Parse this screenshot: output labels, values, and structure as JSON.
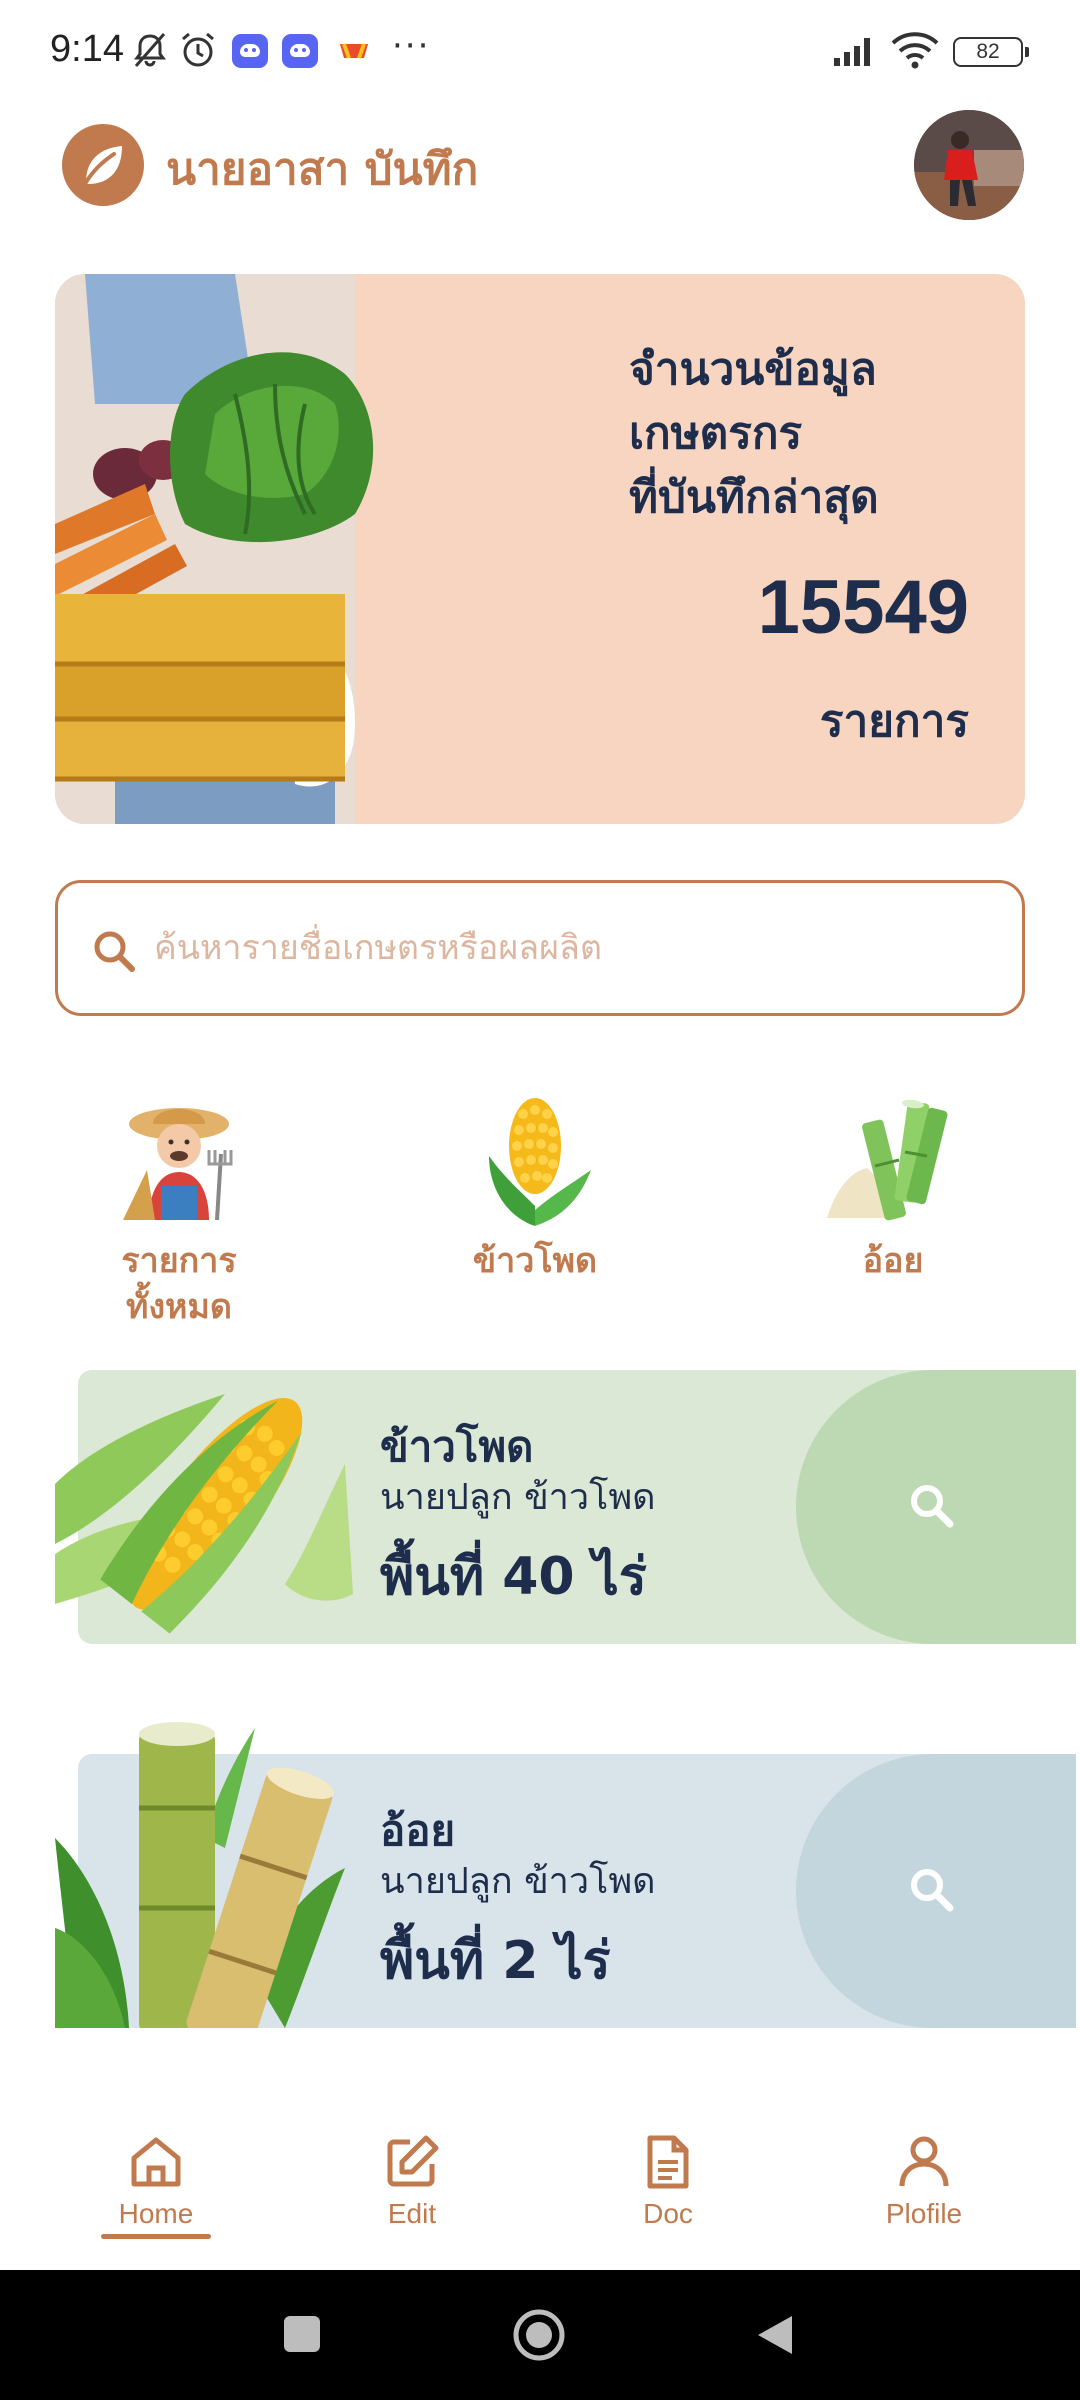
{
  "status_bar": {
    "time": "9:14",
    "battery": "82",
    "more": "···",
    "icons": [
      "bell-off-icon",
      "alarm-icon",
      "discord-icon",
      "discord-icon",
      "app-icon",
      "signal-icon",
      "wifi-icon",
      "battery-icon"
    ]
  },
  "header": {
    "title": "นายอาสา บันทึก",
    "logo_icon": "leaf-icon"
  },
  "hero": {
    "label_line1": "จำนวนข้อมูล",
    "label_line2": "เกษตรกร",
    "label_line3": "ที่บันทึกล่าสุด",
    "count": "15549",
    "unit": "รายการ"
  },
  "search": {
    "placeholder": "ค้นหารายชื่อเกษตรหรือผลผลิต",
    "value": ""
  },
  "categories": [
    {
      "label_line1": "รายการ",
      "label_line2": "ทั้งหมด",
      "icon": "farmer-icon"
    },
    {
      "label_line1": "ข้าวโพด",
      "label_line2": "",
      "icon": "corn-icon"
    },
    {
      "label_line1": "อ้อย",
      "label_line2": "",
      "icon": "sugarcane-icon"
    }
  ],
  "crops": [
    {
      "name": "ข้าวโพด",
      "farmer": "นายปลูก ข้าวโพด",
      "area": "พื้นที่ 40 ไร่",
      "icon": "corn-image"
    },
    {
      "name": "อ้อย",
      "farmer": "นายปลูก ข้าวโพด",
      "area": "พื้นที่ 2 ไร่",
      "icon": "sugarcane-image"
    }
  ],
  "bottom_nav": [
    {
      "label": "Home",
      "icon": "home-icon",
      "active": true
    },
    {
      "label": "Edit",
      "icon": "edit-icon",
      "active": false
    },
    {
      "label": "Doc",
      "icon": "document-icon",
      "active": false
    },
    {
      "label": "Plofile",
      "icon": "user-icon",
      "active": false
    }
  ],
  "colors": {
    "brand": "#c07a4e",
    "text_dark": "#1e2d4b",
    "hero_bg": "#f8d5c0",
    "corn_card_bg": "#dbe8d6",
    "corn_card_accent": "#bcd9b3",
    "cane_card_bg": "#d8e4ea",
    "cane_card_accent": "#c4d6dd"
  }
}
